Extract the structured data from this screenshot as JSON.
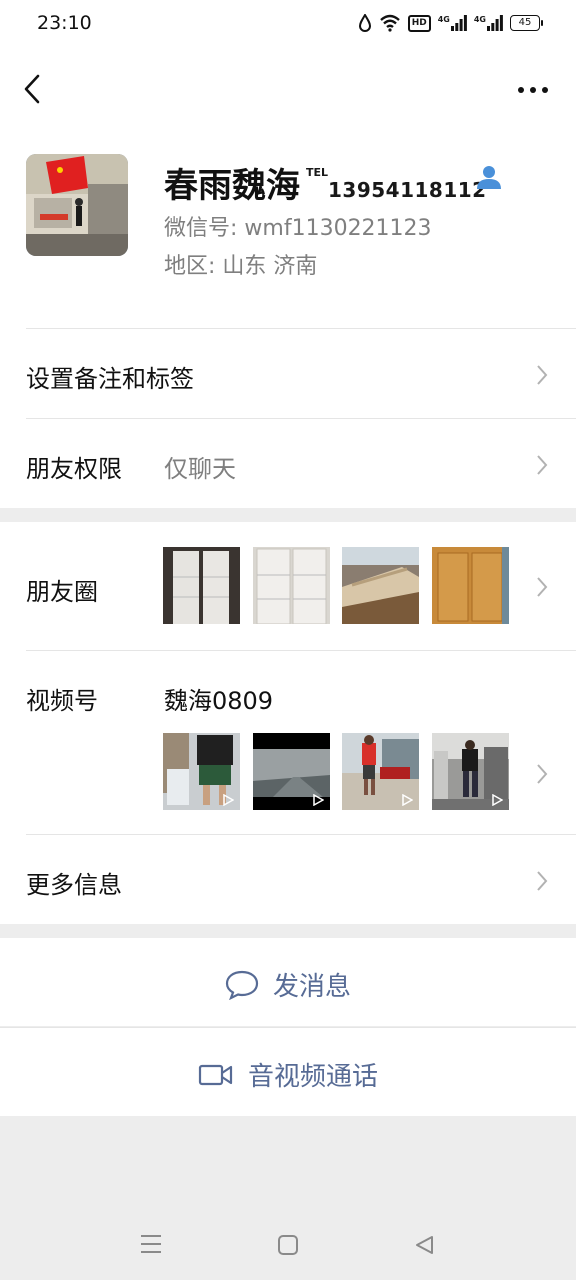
{
  "status_bar": {
    "time": "23:10",
    "hd_label": "HD",
    "net1": "4G",
    "net2": "4G",
    "battery": "45"
  },
  "profile": {
    "name": "春雨魏海",
    "tel_label": "TEL",
    "tel_number": "13954118112",
    "wechat_id": "微信号: wmf1130221123",
    "region": "地区: 山东  济南"
  },
  "settings": {
    "remark_tags": "设置备注和标签",
    "friend_perm_label": "朋友权限",
    "friend_perm_value": "仅聊天"
  },
  "moments": {
    "label": "朋友圈"
  },
  "channels": {
    "label": "视频号",
    "name": "魏海0809"
  },
  "more_info": "更多信息",
  "actions": {
    "message": "发消息",
    "call": "音视频通话"
  },
  "colors": {
    "link": "#576b95",
    "gray_text": "#7f7f7f",
    "accent_icon": "#4a90d9",
    "divider_band": "#ededed"
  }
}
